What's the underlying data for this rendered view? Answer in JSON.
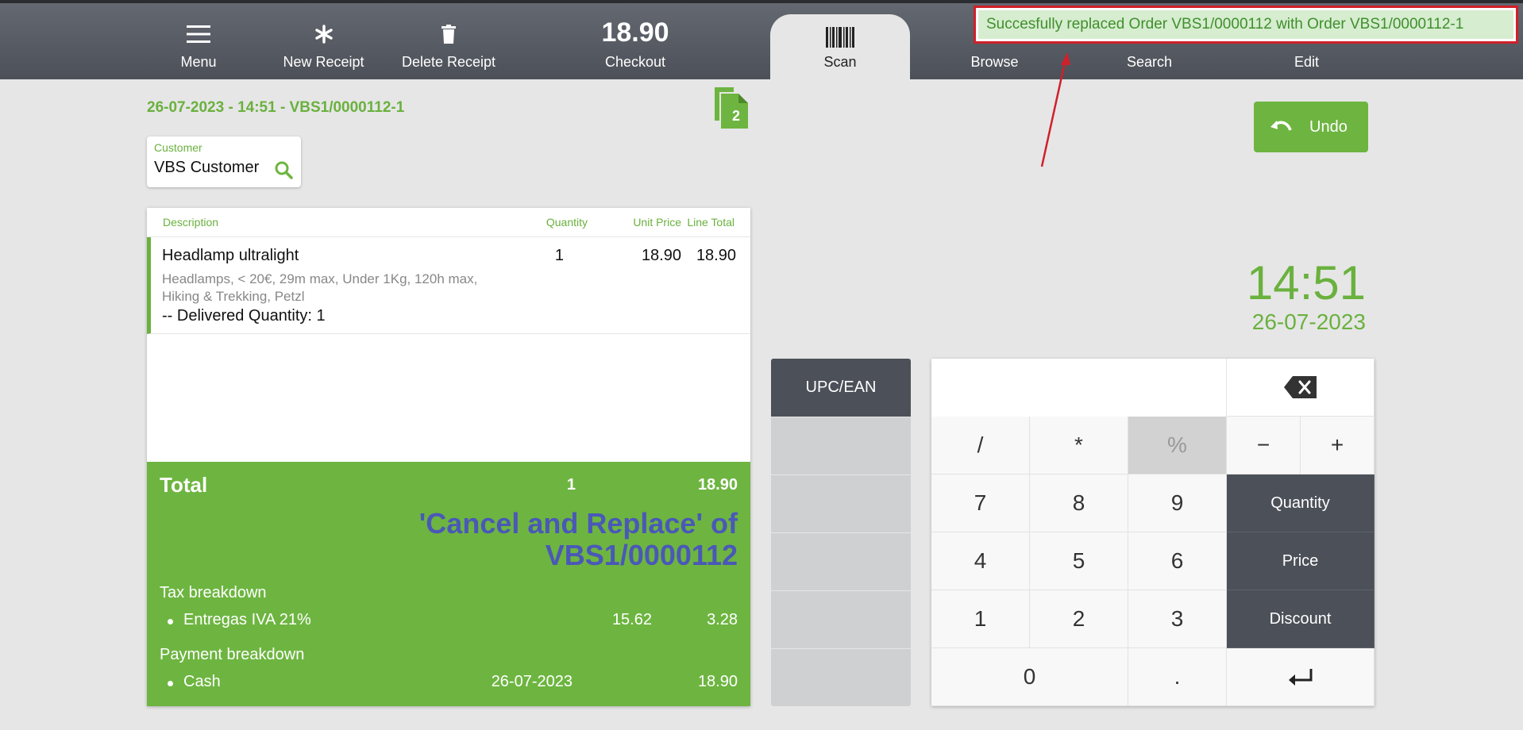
{
  "toolbar": {
    "menu_label": "Menu",
    "new_receipt_label": "New Receipt",
    "delete_receipt_label": "Delete Receipt",
    "checkout_amount": "18.90",
    "checkout_label": "Checkout",
    "scan_label": "Scan",
    "browse_label": "Browse",
    "search_label": "Search",
    "edit_label": "Edit"
  },
  "notification": "Succesfully replaced Order VBS1/0000112 with Order VBS1/0000112-1",
  "order": {
    "title": "26-07-2023 - 14:51 - VBS1/0000112-1",
    "copies_count": "2"
  },
  "customer": {
    "label": "Customer",
    "value": "VBS Customer"
  },
  "receipt": {
    "headers": {
      "description": "Description",
      "quantity": "Quantity",
      "unit_price": "Unit Price",
      "line_total": "Line Total"
    },
    "line": {
      "name": "Headlamp ultralight",
      "quantity": "1",
      "unit_price": "18.90",
      "line_total": "18.90",
      "description": "Headlamps, < 20€, 29m max, Under 1Kg, 120h max, Hiking & Trekking, Petzl",
      "delivered": "-- Delivered Quantity: 1"
    },
    "total_label": "Total",
    "total_quantity": "1",
    "total_amount": "18.90",
    "cancel_note": "'Cancel and Replace' of VBS1/0000112",
    "tax_label": "Tax breakdown",
    "tax_row": {
      "name": "Entregas IVA 21%",
      "base": "15.62",
      "amount": "3.28"
    },
    "payment_label": "Payment breakdown",
    "payment_row": {
      "name": "Cash",
      "date": "26-07-2023",
      "amount": "18.90"
    }
  },
  "search_panel": {
    "upc_label": "UPC/EAN"
  },
  "keypad": {
    "keys": {
      "slash": "/",
      "star": "*",
      "percent": "%",
      "minus": "−",
      "plus": "+",
      "k7": "7",
      "k8": "8",
      "k9": "9",
      "quantity": "Quantity",
      "k4": "4",
      "k5": "5",
      "k6": "6",
      "price": "Price",
      "k1": "1",
      "k2": "2",
      "k3": "3",
      "discount": "Discount",
      "k0": "0",
      "dot": "."
    }
  },
  "undo_label": "Undo",
  "clock": {
    "time": "14:51",
    "date": "26-07-2023"
  },
  "colors": {
    "accent": "#6db540",
    "toolbar": "#4c5058",
    "cancel_note": "#4a58b8",
    "annotation": "#d0202a"
  },
  "icons": [
    "menu-icon",
    "asterisk-icon",
    "trash-icon",
    "barcode-icon",
    "copies-icon",
    "search-icon",
    "undo-icon",
    "backspace-icon",
    "enter-icon"
  ]
}
